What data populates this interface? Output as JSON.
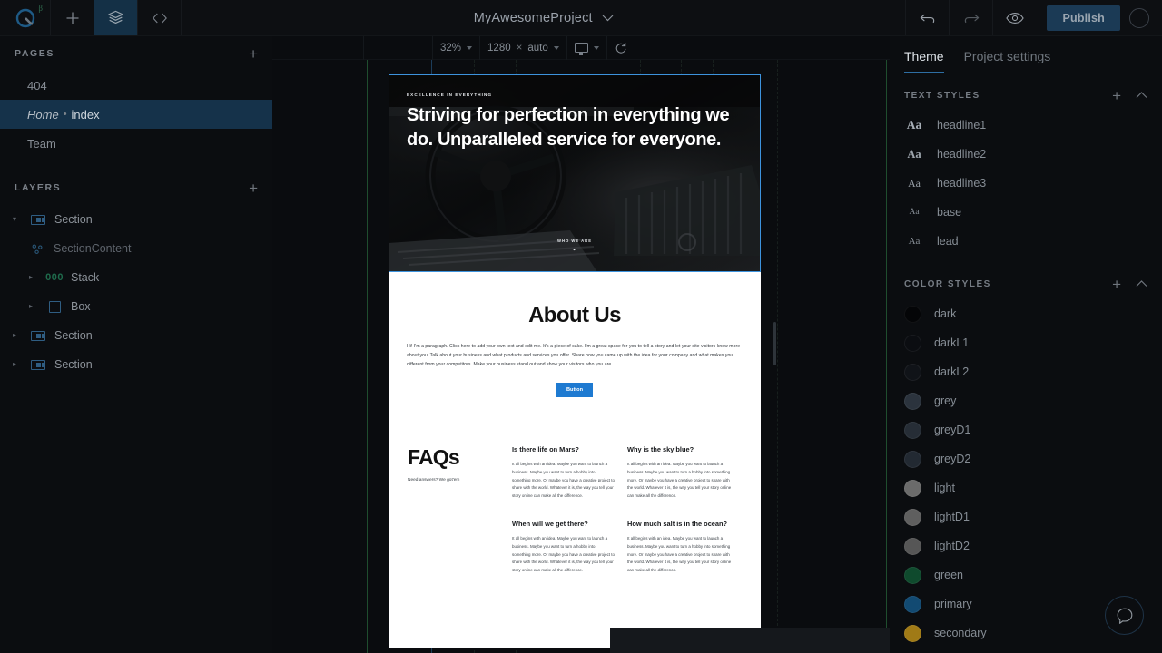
{
  "topbar": {
    "logo_badge": "β",
    "tools": [
      {
        "name": "add-icon",
        "glyph": "+"
      },
      {
        "name": "layers-icon",
        "glyph": "layers"
      },
      {
        "name": "code-icon",
        "glyph": "<>"
      }
    ],
    "project_title": "MyAwesomeProject",
    "project_caret": "⌄",
    "undo": "↶",
    "redo": "↷",
    "preview": "eye",
    "publish_label": "Publish"
  },
  "left_panel": {
    "pages": {
      "title": "PAGES",
      "add_label": "+",
      "items": [
        {
          "label": "404",
          "slug": "",
          "selected": false
        },
        {
          "label": "Home",
          "slug": "index",
          "selected": true
        },
        {
          "label": "Team",
          "slug": "",
          "selected": false
        }
      ]
    },
    "layers": {
      "title": "LAYERS",
      "add_label": "+",
      "items": [
        {
          "label": "Section",
          "icon": "section-icon",
          "depth": 0,
          "expanded": true
        },
        {
          "label": "SectionContent",
          "icon": "content-icon",
          "depth": 1,
          "expanded": false
        },
        {
          "label": "Stack",
          "icon": "stack-icon",
          "depth": 1,
          "expanded": false
        },
        {
          "label": "Box",
          "icon": "box-icon",
          "depth": 1,
          "expanded": false
        },
        {
          "label": "Section",
          "icon": "section-icon",
          "depth": 0,
          "expanded": false
        },
        {
          "label": "Section",
          "icon": "section-icon",
          "depth": 0,
          "expanded": false
        }
      ]
    }
  },
  "canvas_toolbar": {
    "zoom": "32%",
    "width": "1280",
    "times": "×",
    "height": "auto",
    "device": "desktop-icon",
    "refresh": "↻"
  },
  "page": {
    "hero": {
      "eyebrow": "EXCELLENCE IN EVERYTHING",
      "headline": "Striving for perfection in everything we do. Unparalleled service for everyone.",
      "scroll_label": "WHO WE ARE",
      "scroll_arrow": "⌄"
    },
    "about": {
      "heading": "About Us",
      "paragraph": "Hi! I'm a paragraph. Click here to add your own text and edit me. It's a piece of cake. I'm a great space for you to tell a story and let your site visitors know more about you. Talk about your business and what products and services you offer. Share how you came up with the idea for your company and what makes you different from your competitors. Make your business stand out and show your visitors who you are.",
      "button_label": "Button",
      "button_color": "#1e7ad1"
    },
    "faqs": {
      "heading": "FAQs",
      "subheading": "Need answers? We got'em",
      "answer": "It all begins with an idea. Maybe you want to launch a business. Maybe you want to turn a hobby into something more. Or maybe you have a creative project to share with the world. Whatever it is, the way you tell your story online can make all the difference.",
      "items": [
        {
          "question": "Is there life on Mars?"
        },
        {
          "question": "Why is the sky blue?"
        },
        {
          "question": "When will we get there?"
        },
        {
          "question": "How much salt is in the ocean?"
        }
      ]
    }
  },
  "right_panel": {
    "tabs": [
      {
        "label": "Theme",
        "active": true
      },
      {
        "label": "Project settings",
        "active": false
      }
    ],
    "text_styles": {
      "title": "TEXT STYLES",
      "add_label": "+",
      "collapse": "⌃",
      "items": [
        {
          "label": "headline1",
          "sample": "Aa"
        },
        {
          "label": "headline2",
          "sample": "Aa"
        },
        {
          "label": "headline3",
          "sample": "Aa"
        },
        {
          "label": "base",
          "sample": "Aa"
        },
        {
          "label": "lead",
          "sample": "Aa"
        }
      ]
    },
    "color_styles": {
      "title": "COLOR STYLES",
      "add_label": "+",
      "collapse": "⌃",
      "items": [
        {
          "label": "dark",
          "hex": "#040507"
        },
        {
          "label": "darkL1",
          "hex": "#0b0d11"
        },
        {
          "label": "darkL2",
          "hex": "#101318"
        },
        {
          "label": "grey",
          "hex": "#2b333d"
        },
        {
          "label": "greyD1",
          "hex": "#262d36"
        },
        {
          "label": "greyD2",
          "hex": "#222932"
        },
        {
          "label": "light",
          "hex": "#6b6b6b"
        },
        {
          "label": "lightD1",
          "hex": "#5f5f5f"
        },
        {
          "label": "lightD2",
          "hex": "#565656"
        },
        {
          "label": "green",
          "hex": "#0f4a2d"
        },
        {
          "label": "primary",
          "hex": "#124a72"
        },
        {
          "label": "secondary",
          "hex": "#a07a16"
        }
      ]
    },
    "help_icon": "chat-bubble-icon"
  }
}
